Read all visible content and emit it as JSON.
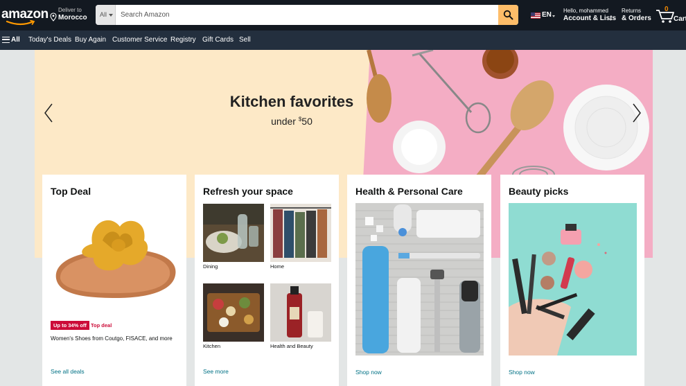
{
  "header": {
    "logo_text": "amazon",
    "deliver_label": "Deliver to",
    "deliver_location": "Morocco",
    "search": {
      "category": "All",
      "placeholder": "Search Amazon"
    },
    "language": "EN",
    "account_greeting": "Hello, mohammed",
    "account_label": "Account & Lists",
    "returns_label": "Returns",
    "orders_label": "& Orders",
    "cart_count": "0",
    "cart_label": "Cart"
  },
  "subnav": {
    "all_label": "All",
    "items": [
      "Today's Deals",
      "Buy Again",
      "Customer Service",
      "Registry",
      "Gift Cards",
      "Sell"
    ]
  },
  "hero": {
    "title": "Kitchen favorites",
    "subtitle_prefix": "under ",
    "subtitle_currency": "$",
    "subtitle_amount": "50"
  },
  "cards": [
    {
      "title": "Top Deal",
      "badge": "Up to 34% off",
      "badge_label": "Top deal",
      "description": "Women's Shoes from Coutgo, FISACE, and more",
      "link": "See all deals"
    },
    {
      "title": "Refresh your space",
      "tiles": [
        "Dining",
        "Home",
        "Kitchen",
        "Health and Beauty"
      ],
      "link": "See more"
    },
    {
      "title": "Health & Personal Care",
      "link": "Shop now"
    },
    {
      "title": "Beauty picks",
      "link": "Shop now"
    }
  ],
  "colors": {
    "nav_dark": "#131921",
    "nav_sub": "#232f3e",
    "search_button": "#febd69",
    "link": "#007185",
    "deal_red": "#cc0c39",
    "cart_count": "#f08804"
  }
}
